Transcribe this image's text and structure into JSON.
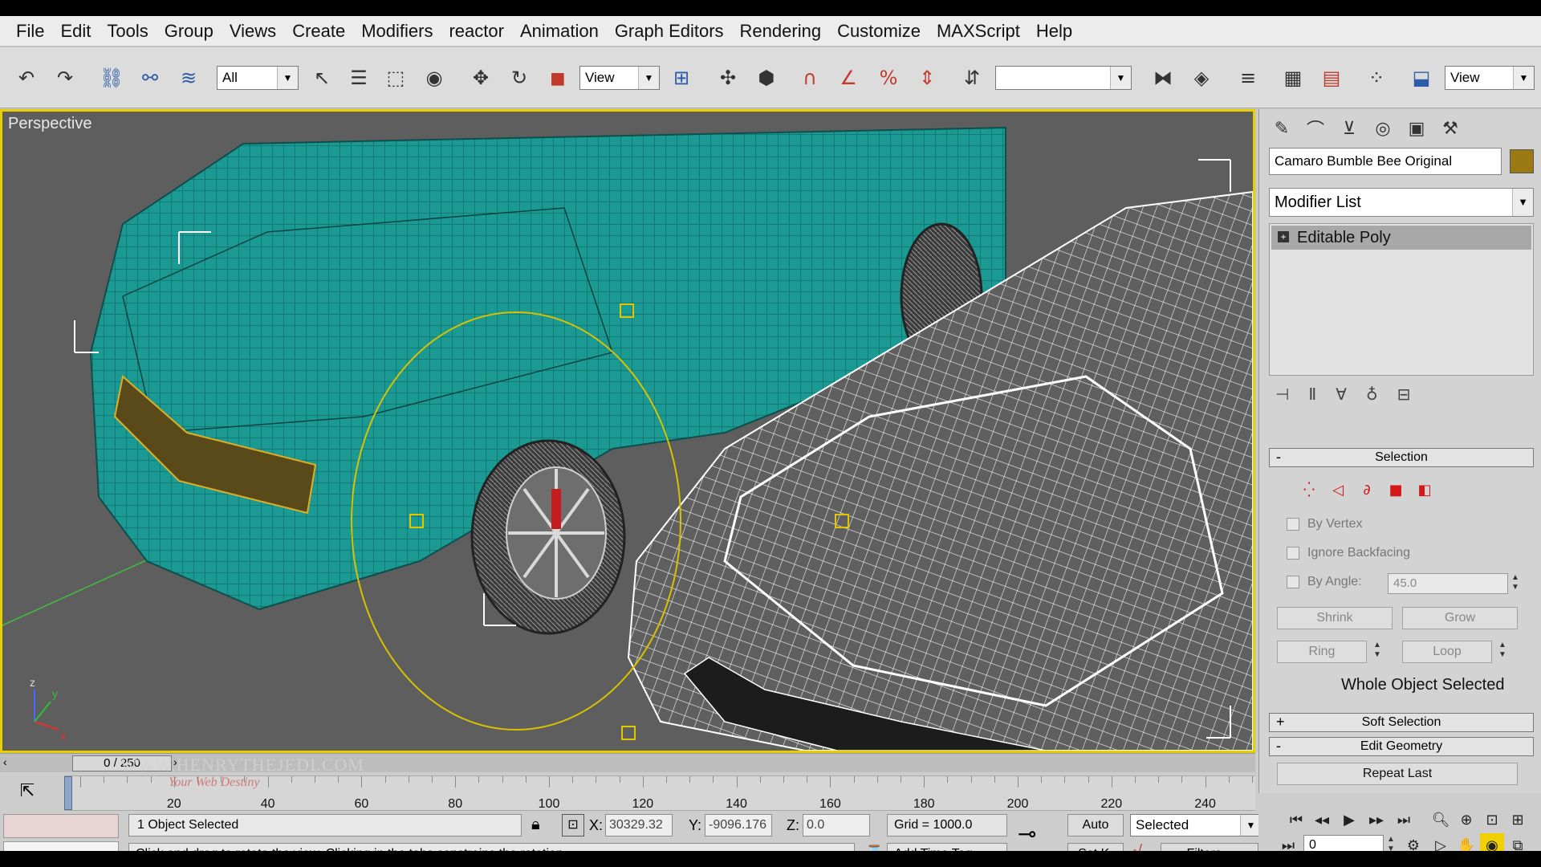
{
  "menubar": {
    "items": [
      "File",
      "Edit",
      "Tools",
      "Group",
      "Views",
      "Create",
      "Modifiers",
      "reactor",
      "Animation",
      "Graph Editors",
      "Rendering",
      "Customize",
      "MAXScript",
      "Help"
    ]
  },
  "toolbar": {
    "selection_filter": "All",
    "ref_coord": "View",
    "named_selection": "",
    "view_dropdown": "View",
    "icons": [
      "undo-icon",
      "redo-icon",
      "select-link-icon",
      "unlink-icon",
      "bind-spacewarp-icon",
      "select-object-icon",
      "select-by-name-icon",
      "rect-region-icon",
      "window-crossing-icon",
      "move-icon",
      "rotate-icon",
      "scale-icon",
      "pivot-icon",
      "manipulate-icon",
      "keyboard-shortcut-icon",
      "snap-3-icon",
      "angle-snap-icon",
      "percent-snap-icon",
      "spinner-snap-icon",
      "edit-named-selection-icon",
      "mirror-icon",
      "align-icon",
      "layer-manager-icon",
      "curve-editor-icon",
      "schematic-view-icon",
      "material-editor-icon",
      "render-scene-icon"
    ]
  },
  "viewport": {
    "label": "Perspective",
    "axis_labels": {
      "x": "x",
      "y": "y",
      "z": "z"
    },
    "colors": {
      "background": "#5e5e5e",
      "selected_mesh": "#1b9a94",
      "wire": "#ffffff",
      "gizmo": "#d8c200",
      "border": "#e8d000"
    }
  },
  "watermark": {
    "main": "WWW.HENRYTHEJEDI.COM",
    "sub": "Your Web Destiny"
  },
  "cmdpanel": {
    "tabs": [
      "create-icon",
      "modify-icon",
      "hierarchy-icon",
      "motion-icon",
      "display-icon",
      "utilities-icon"
    ],
    "object_name": "Camaro Bumble Bee Original",
    "object_color": "#9b7a16",
    "modifier_list": "Modifier List",
    "stack": [
      {
        "label": "Editable Poly",
        "expand": "+"
      }
    ],
    "selection": {
      "title": "Selection",
      "collapse": "-",
      "modes": [
        "vertex-icon",
        "edge-icon",
        "border-icon",
        "polygon-icon",
        "element-icon"
      ],
      "by_vertex": "By Vertex",
      "ignore_backfacing": "Ignore Backfacing",
      "by_angle": "By Angle:",
      "angle_value": "45.0",
      "shrink": "Shrink",
      "grow": "Grow",
      "ring": "Ring",
      "loop": "Loop",
      "status": "Whole Object Selected"
    },
    "soft_selection": {
      "title": "Soft Selection",
      "expand": "+"
    },
    "edit_geometry": {
      "title": "Edit Geometry",
      "collapse": "-",
      "repeat_last": "Repeat Last"
    }
  },
  "timeline": {
    "frame_display": "0 / 250",
    "ticks": [
      20,
      40,
      60,
      80,
      100,
      120,
      140,
      160,
      180,
      200,
      220,
      240
    ]
  },
  "status": {
    "selection": "1 Object Selected",
    "prompt": "Click and drag to rotate the view.  Clicking in the tabs constrains the rotation",
    "x_label": "X:",
    "x_value": "30329.32",
    "y_label": "Y:",
    "y_value": "-9096.176",
    "z_label": "Z:",
    "z_value": "0.0",
    "grid": "Grid = 1000.0",
    "add_time_tag": "Add Time Tag",
    "auto_key": "Auto",
    "set_key": "Set K.",
    "key_filter": "Selected",
    "filters": "Filters...",
    "current_frame": "0"
  }
}
